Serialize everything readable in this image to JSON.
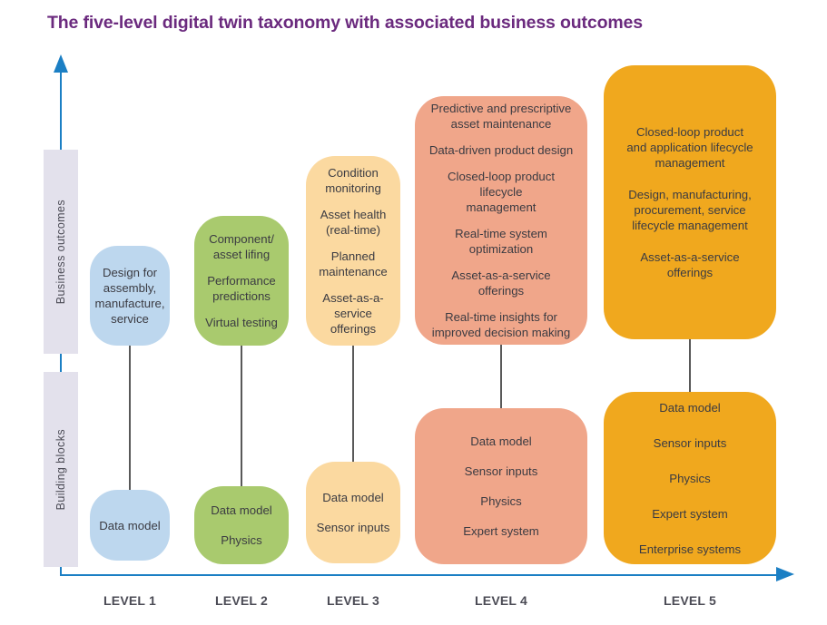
{
  "title": "The five-level digital twin taxonomy with associated business outcomes",
  "axes": {
    "y_bands": [
      {
        "id": "business-outcomes",
        "label": "Business outcomes"
      },
      {
        "id": "building-blocks",
        "label": "Building blocks"
      }
    ],
    "x_labels": [
      "LEVEL 1",
      "LEVEL 2",
      "LEVEL 3",
      "LEVEL 4",
      "LEVEL 5"
    ],
    "axis_color": "#1b7fc4"
  },
  "colors": {
    "title": "#6b2a7e",
    "level1": "#bdd7ee",
    "level2": "#a9ca6e",
    "level3": "#fbd9a0",
    "level4": "#f0a68a",
    "level5": "#f0a81e",
    "band_bg": "#e3e1ec",
    "text": "#3b3b42",
    "connector": "#595959"
  },
  "levels": [
    {
      "id": "level-1",
      "label": "LEVEL 1",
      "color": "#bdd7ee",
      "business_outcomes": [
        "Design for\nassembly,\nmanufacture,\nservice"
      ],
      "building_blocks": [
        "Data model"
      ]
    },
    {
      "id": "level-2",
      "label": "LEVEL 2",
      "color": "#a9ca6e",
      "business_outcomes": [
        "Component/\nasset lifing",
        "Performance\npredictions",
        "Virtual testing"
      ],
      "building_blocks": [
        "Data model",
        "Physics"
      ]
    },
    {
      "id": "level-3",
      "label": "LEVEL 3",
      "color": "#fbd9a0",
      "business_outcomes": [
        "Condition\nmonitoring",
        "Asset health\n(real-time)",
        "Planned\nmaintenance",
        "Asset-as-a-\nservice\nofferings"
      ],
      "building_blocks": [
        "Data model",
        "Sensor inputs"
      ]
    },
    {
      "id": "level-4",
      "label": "LEVEL 4",
      "color": "#f0a68a",
      "business_outcomes": [
        "Predictive and prescriptive\nasset maintenance",
        "Data-driven product design",
        "Closed-loop product\nlifecycle\nmanagement",
        "Real-time system\noptimization",
        "Asset-as-a-service\nofferings",
        "Real-time insights for\nimproved decision making"
      ],
      "building_blocks": [
        "Data model",
        "Sensor inputs",
        "Physics",
        "Expert system"
      ]
    },
    {
      "id": "level-5",
      "label": "LEVEL 5",
      "color": "#f0a81e",
      "business_outcomes": [
        "Closed-loop product\nand application lifecycle\nmanagement",
        "Design, manufacturing,\nprocurement, service\nlifecycle management",
        "Asset-as-a-service\nofferings"
      ],
      "building_blocks": [
        "Data model",
        "Sensor inputs",
        "Physics",
        "Expert system",
        "Enterprise systems"
      ]
    }
  ]
}
